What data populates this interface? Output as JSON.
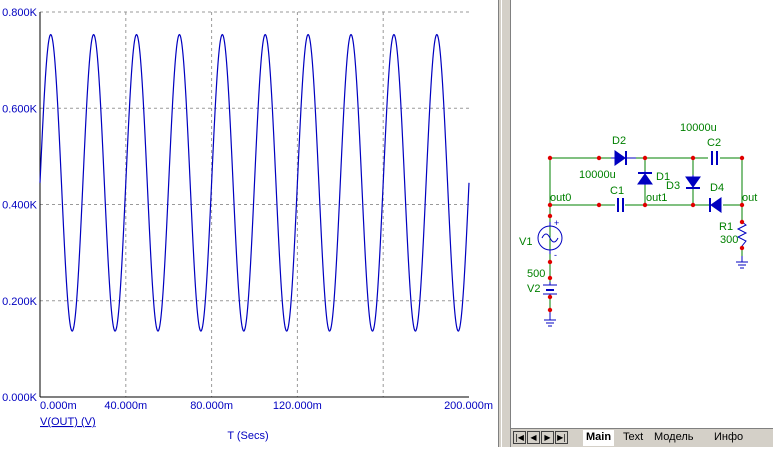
{
  "chart_data": {
    "type": "line",
    "xlabel": "T (Secs)",
    "ylabel": "",
    "xlim": [
      0,
      0.2
    ],
    "ylim": [
      0,
      800
    ],
    "x_ticks": [
      "0.000m",
      "40.000m",
      "80.000m",
      "120.000m",
      "200.000m"
    ],
    "y_ticks": [
      "0.000K",
      "0.200K",
      "0.400K",
      "0.600K",
      "0.800K"
    ],
    "grid": true,
    "series": [
      {
        "name": "V(OUT) (V)",
        "color": "#0000c0",
        "waveform": "sine",
        "offset": 445,
        "amplitude": 308,
        "frequency_hz": 50,
        "peak_value": 753,
        "trough_value": 137,
        "start_value": 445
      }
    ]
  },
  "schematic": {
    "wire_color": "#008000",
    "node_color": "#e00000",
    "component_color": "#0000c0",
    "labels": {
      "d2": "D2",
      "c2_value": "10000u",
      "c2": "C2",
      "c1_value": "10000u",
      "d1": "D1",
      "d3": "D3",
      "c1": "C1",
      "d4": "D4",
      "out0": "out0",
      "out1": "out1",
      "out": "out",
      "v1": "V1",
      "r1": "R1",
      "r1_value": "300",
      "v2_value": "500",
      "v2": "V2",
      "plus": "+",
      "minus": "-"
    }
  },
  "tabs": {
    "items": [
      "Main",
      "Text",
      "Модель",
      "Инфо"
    ],
    "active": "Main"
  },
  "nav_icons": [
    "first-icon",
    "prev-icon",
    "next-icon",
    "last-icon"
  ]
}
